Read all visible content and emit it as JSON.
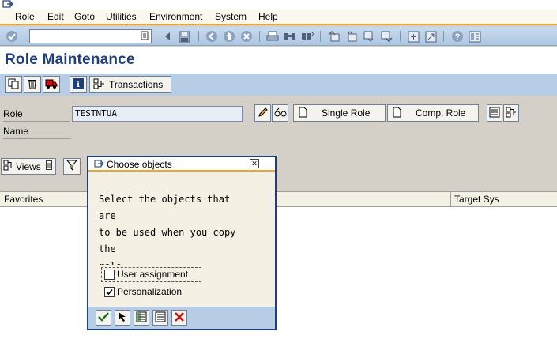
{
  "menu": [
    "Role",
    "Edit",
    "Goto",
    "Utilities",
    "Environment",
    "System",
    "Help"
  ],
  "command_field": {
    "value": ""
  },
  "page_title": "Role Maintenance",
  "app_toolbar": {
    "transactions_label": "Transactions"
  },
  "form": {
    "role_label": "Role",
    "role_value": "TESTNTUA",
    "name_label": "Name",
    "single_role_label": "Single Role",
    "comp_role_label": "Comp. Role"
  },
  "lower_toolbar": {
    "views_label": "Views"
  },
  "table": {
    "columns": [
      "Favorites",
      "Target Sys"
    ],
    "rows": []
  },
  "popup": {
    "title": "Choose objects",
    "message_lines": [
      "Select the objects that",
      "are",
      "to be used when you copy",
      "the",
      "role"
    ],
    "options": [
      {
        "label": "User assignment",
        "checked": false
      },
      {
        "label": "Personalization",
        "checked": true
      }
    ]
  },
  "colors": {
    "title_blue": "#1f3e7c",
    "toolbar_blue": "#b7cde6",
    "accent_orange": "#e8a736",
    "input_bg": "#e8eef7"
  },
  "icons": {
    "standard_toolbar": [
      "enter-icon",
      "save-icon",
      "back-icon",
      "exit-icon",
      "cancel-icon",
      "print-icon",
      "find-icon",
      "find-next-icon",
      "first-page-icon",
      "previous-page-icon",
      "next-page-icon",
      "last-page-icon",
      "create-session-icon",
      "shortcut-icon",
      "help-icon",
      "layout-menu-icon"
    ],
    "app_toolbar": [
      "copy-icon",
      "delete-icon",
      "transport-icon",
      "info-icon",
      "transactions-icon"
    ],
    "popup_footer": [
      "confirm-icon",
      "select-all-icon",
      "select-block-icon",
      "deselect-all-icon",
      "cancel-icon"
    ]
  }
}
